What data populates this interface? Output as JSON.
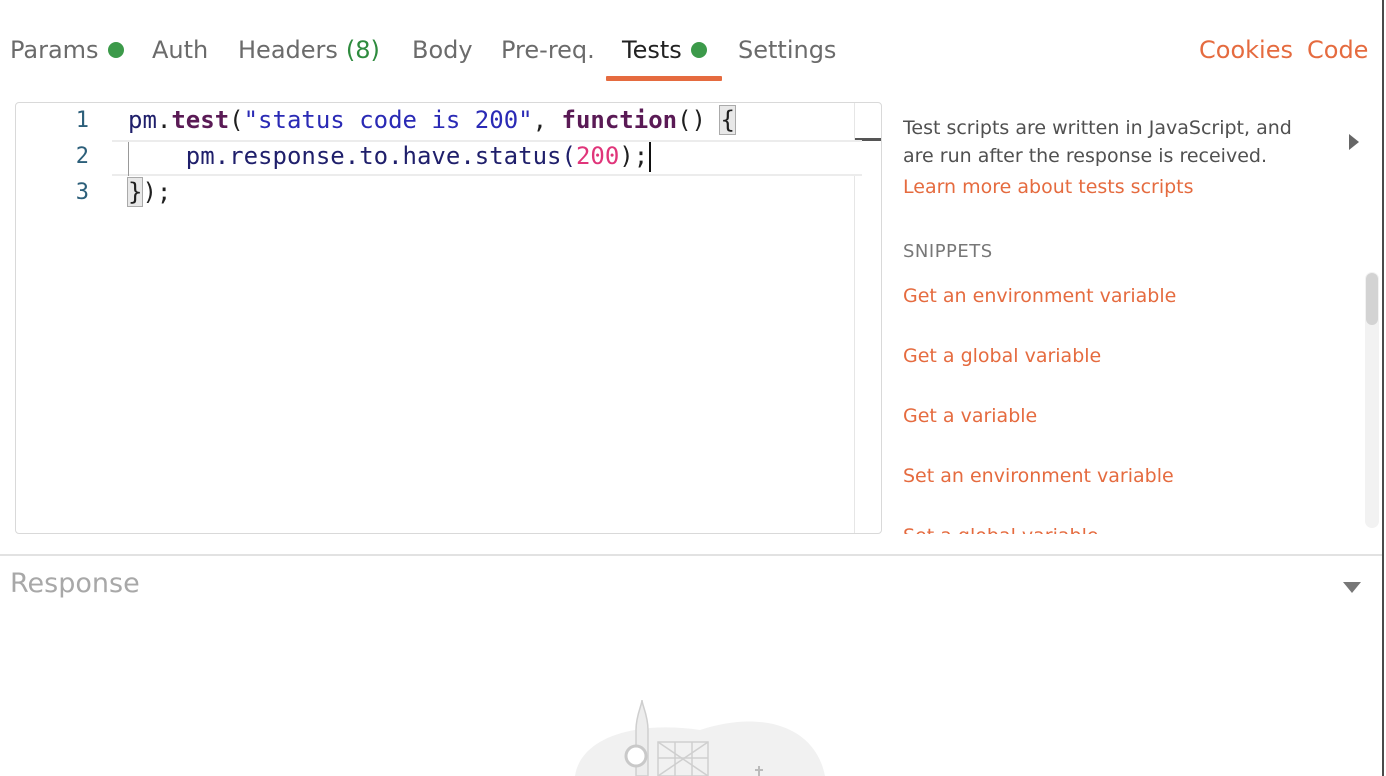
{
  "tabs": [
    {
      "label": "Params",
      "indicator": "green-dot"
    },
    {
      "label": "Auth"
    },
    {
      "label": "Headers",
      "count": "(8)"
    },
    {
      "label": "Body"
    },
    {
      "label": "Pre-req."
    },
    {
      "label": "Tests",
      "indicator": "green-dot",
      "active": true
    },
    {
      "label": "Settings"
    }
  ],
  "links": {
    "cookies": "Cookies",
    "code": "Code"
  },
  "editor": {
    "line_numbers": [
      "1",
      "2",
      "3"
    ],
    "code": {
      "l1_var": "pm",
      "l1_dot": ".",
      "l1_fn": "test",
      "l1_open": "(",
      "l1_str": "\"status code is 200\"",
      "l1_comma": ", ",
      "l1_kw": "function",
      "l1_parens": "() ",
      "l1_brace": "{",
      "l2_indent": "    ",
      "l2_chain": "pm.response.to.have.status(",
      "l2_num": "200",
      "l2_close": ");",
      "l3_brace": "}",
      "l3_close": ");"
    }
  },
  "panel": {
    "description": "Test scripts are written in JavaScript, and are run after the response is received.",
    "learn_more": "Learn more about tests scripts",
    "snippets_title": "SNIPPETS",
    "snippets": [
      "Get an environment variable",
      "Get a global variable",
      "Get a variable",
      "Set an environment variable",
      "Set a global variable"
    ]
  },
  "response": {
    "title": "Response"
  },
  "colors": {
    "accent": "#e56b3f",
    "status_dot": "#3c9a4a",
    "count": "#2e8b3e"
  }
}
